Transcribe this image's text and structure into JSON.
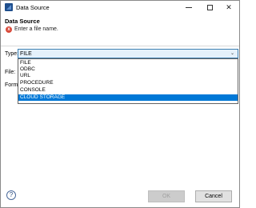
{
  "window": {
    "title": "Data Source",
    "minimize_icon": "minimize-icon",
    "maximize_icon": "maximize-icon",
    "close_icon": "close-icon",
    "close_glyph": "✕"
  },
  "header": {
    "title": "Data Source",
    "error_icon": "error-icon",
    "error_glyph": "x",
    "message": "Enter a file name."
  },
  "form": {
    "type_label": "Type:",
    "type_value": "FILE",
    "file_label": "File:",
    "format_label": "Form",
    "dropdown_arrow": "⌄",
    "type_options": [
      {
        "label": "FILE",
        "selected": false
      },
      {
        "label": "ODBC",
        "selected": false
      },
      {
        "label": "URL",
        "selected": false
      },
      {
        "label": "PROCEDURE",
        "selected": false
      },
      {
        "label": "CONSOLE",
        "selected": false
      },
      {
        "label": "CLOUD STORAGE",
        "selected": true
      }
    ]
  },
  "footer": {
    "help_glyph": "?",
    "ok_label": "OK",
    "cancel_label": "Cancel"
  },
  "colors": {
    "selection": "#0078d7",
    "error": "#d94a3a",
    "combo_border": "#3c7fb1"
  }
}
